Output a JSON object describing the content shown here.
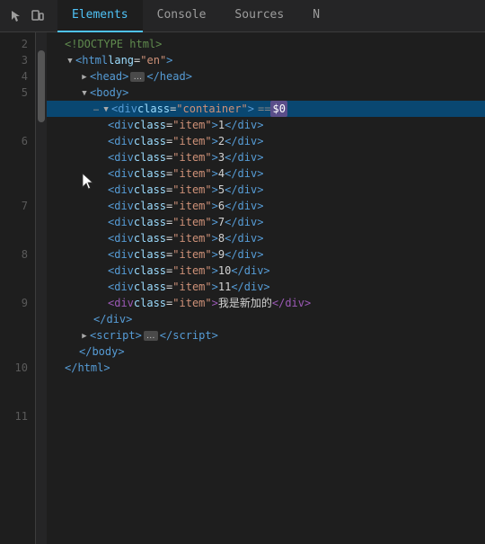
{
  "toolbar": {
    "tabs": [
      "Elements",
      "Console",
      "Sources",
      "N"
    ],
    "active_tab": "Elements"
  },
  "line_numbers": [
    2,
    3,
    4,
    5,
    6,
    7,
    8,
    9,
    10,
    11
  ],
  "dom_lines": [
    {
      "indent": 1,
      "content": "doctype",
      "text": "<!DOCTYPE html>",
      "type": "comment"
    },
    {
      "indent": 1,
      "content": "html_open",
      "text": "<html lang=\"en\">",
      "type": "tag"
    },
    {
      "indent": 2,
      "content": "head",
      "text": "<head>",
      "type": "tag_collapsed",
      "has_triangle": true
    },
    {
      "indent": 2,
      "content": "body_open",
      "text": "<body>",
      "type": "tag"
    },
    {
      "indent": 3,
      "content": "container_div",
      "text": "<div class=\"container\"> == $0",
      "type": "selected",
      "has_dots": true,
      "has_triangle": true
    },
    {
      "indent": 4,
      "content": "item1",
      "text": "<div class=\"item\">1</div>"
    },
    {
      "indent": 4,
      "content": "item2",
      "text": "<div class=\"item\">2</div>"
    },
    {
      "indent": 4,
      "content": "item3",
      "text": "<div class=\"item\">3</div>"
    },
    {
      "indent": 4,
      "content": "item4",
      "text": "<div class=\"item\">4</div>"
    },
    {
      "indent": 4,
      "content": "item5",
      "text": "<div class=\"item\">5</div>"
    },
    {
      "indent": 4,
      "content": "item6",
      "text": "<div class=\"item\">6</div>"
    },
    {
      "indent": 4,
      "content": "item7",
      "text": "<div class=\"item\">7</div>"
    },
    {
      "indent": 4,
      "content": "item8",
      "text": "<div class=\"item\">8</div>"
    },
    {
      "indent": 4,
      "content": "item9",
      "text": "<div class=\"item\">9</div>"
    },
    {
      "indent": 4,
      "content": "item10",
      "text": "<div class=\"item\">10</div>"
    },
    {
      "indent": 4,
      "content": "item11",
      "text": "<div class=\"item\">11</div>"
    },
    {
      "indent": 4,
      "content": "item_new",
      "text": "我是新加的",
      "type": "new_item"
    },
    {
      "indent": 3,
      "content": "div_close",
      "text": "</div>"
    },
    {
      "indent": 2,
      "content": "script",
      "text": "<script>",
      "type": "tag_collapsed",
      "has_triangle": true
    },
    {
      "indent": 2,
      "content": "body_close",
      "text": "</body>"
    },
    {
      "indent": 1,
      "content": "html_close",
      "text": "</html>"
    }
  ]
}
